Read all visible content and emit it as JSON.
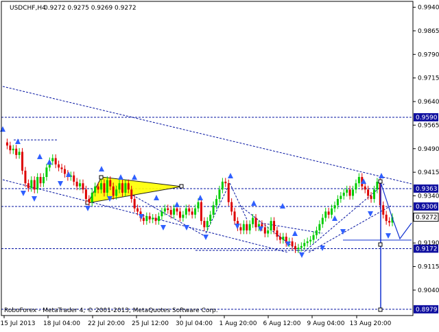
{
  "chart_data": {
    "type": "candlestick",
    "symbol": "USDCHF,H4",
    "ohlc_header": "0.9272 0.9275 0.9269 0.9272",
    "y_ticks": [
      0.994,
      0.9865,
      0.979,
      0.9715,
      0.964,
      0.9565,
      0.949,
      0.9415,
      0.934,
      0.919,
      0.9115,
      0.904
    ],
    "ylim": [
      0.895,
      1.0
    ],
    "x_labels": [
      "15 Jul 2013",
      "18 Jul 04:00",
      "22 Jul 20:00",
      "25 Jul 12:00",
      "30 Jul 04:00",
      "1 Aug 20:00",
      "6 Aug 12:00",
      "9 Aug 04:00",
      "13 Aug 20:00"
    ],
    "levels": [
      {
        "price": 0.959,
        "label": "0.9590"
      },
      {
        "price": 0.9363,
        "label": "0.9363"
      },
      {
        "price": 0.9306,
        "label": "0.9306"
      },
      {
        "price": 0.9172,
        "label": "0.9172"
      },
      {
        "price": 0.8979,
        "label": "0.8979"
      }
    ],
    "current_price": {
      "value": 0.9272,
      "label": "0.9272"
    },
    "price_path": [
      0.951,
      0.95,
      0.9485,
      0.949,
      0.947,
      0.948,
      0.942,
      0.938,
      0.9365,
      0.939,
      0.936,
      0.94,
      0.938,
      0.94,
      0.943,
      0.945,
      0.946,
      0.944,
      0.943,
      0.9425,
      0.941,
      0.94,
      0.9405,
      0.9385,
      0.937,
      0.938,
      0.936,
      0.933,
      0.932,
      0.935,
      0.937,
      0.936,
      0.938,
      0.935,
      0.939,
      0.937,
      0.934,
      0.936,
      0.938,
      0.935,
      0.938,
      0.936,
      0.933,
      0.93,
      0.929,
      0.927,
      0.926,
      0.9275,
      0.9265,
      0.927,
      0.926,
      0.9275,
      0.929,
      0.93,
      0.9295,
      0.928,
      0.93,
      0.929,
      0.927,
      0.928,
      0.93,
      0.929,
      0.928,
      0.93,
      0.932,
      0.926,
      0.924,
      0.926,
      0.928,
      0.931,
      0.933,
      0.936,
      0.9385,
      0.938,
      0.932,
      0.929,
      0.926,
      0.924,
      0.923,
      0.925,
      0.923,
      0.925,
      0.927,
      0.924,
      0.925,
      0.924,
      0.922,
      0.923,
      0.926,
      0.923,
      0.921,
      0.92,
      0.921,
      0.919,
      0.9195,
      0.918,
      0.917,
      0.9175,
      0.918,
      0.919,
      0.9195,
      0.92,
      0.9215,
      0.923,
      0.925,
      0.927,
      0.929,
      0.928,
      0.93,
      0.931,
      0.933,
      0.934,
      0.935,
      0.936,
      0.934,
      0.936,
      0.938,
      0.94,
      0.937,
      0.936,
      0.934,
      0.933,
      0.936,
      0.9385,
      0.931,
      0.928,
      0.926,
      0.9255,
      0.9272
    ],
    "forecast_path": [
      0.9272,
      0.9225,
      0.927
    ]
  },
  "footer": {
    "copyright": "RoboForex - MetaTrader 4, © 2001-2013, MetaQuotes Software Corp."
  },
  "colors": {
    "bull": "#00cc00",
    "bear": "#dd0000",
    "level_box": "#1010a0",
    "pattern_fill": "#ffff00",
    "forecast": "#1030d0"
  }
}
